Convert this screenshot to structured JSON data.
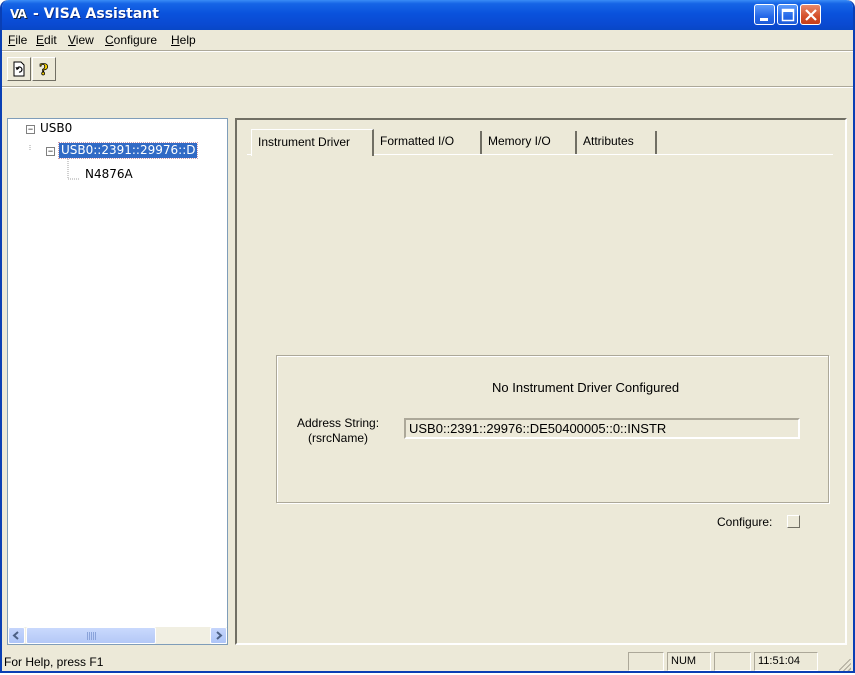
{
  "window": {
    "app_icon_text": "VA",
    "title": " - VISA Assistant",
    "controls": [
      "minimize-icon",
      "maximize-icon",
      "close-icon"
    ]
  },
  "menu": [
    {
      "label": "File",
      "mnemonic": "F"
    },
    {
      "label": "Edit",
      "mnemonic": "E"
    },
    {
      "label": "View",
      "mnemonic": "V"
    },
    {
      "label": "Configure",
      "mnemonic": "C"
    },
    {
      "label": "Help",
      "mnemonic": "H"
    }
  ],
  "toolbar": {
    "buttons": [
      {
        "icon": "refresh-icon"
      },
      {
        "icon": "help-question-icon"
      }
    ]
  },
  "tree": {
    "root": {
      "label": "USB0",
      "expander": "−"
    },
    "device": {
      "label": "USB0::2391::29976::D",
      "expander": "−",
      "selected": true
    },
    "child": {
      "label": "N4876A"
    }
  },
  "tabs": [
    {
      "label": "Instrument Driver",
      "active": true
    },
    {
      "label": "Formatted I/O",
      "active": false
    },
    {
      "label": "Memory I/O",
      "active": false
    },
    {
      "label": "Attributes",
      "active": false
    }
  ],
  "panel": {
    "message": "No Instrument Driver Configured",
    "address_label_line1": "Address String:",
    "address_label_line2": "(rsrcName)",
    "address_value": "USB0::2391::29976::DE50400005::0::INSTR",
    "configure_label": "Configure:"
  },
  "statusbar": {
    "help_text": "For Help, press F1",
    "num": "NUM",
    "time": "11:51:04"
  },
  "colors": {
    "titlebar": "#0a52dc",
    "selection": "#316ac5",
    "window_bg": "#ece9d8"
  }
}
